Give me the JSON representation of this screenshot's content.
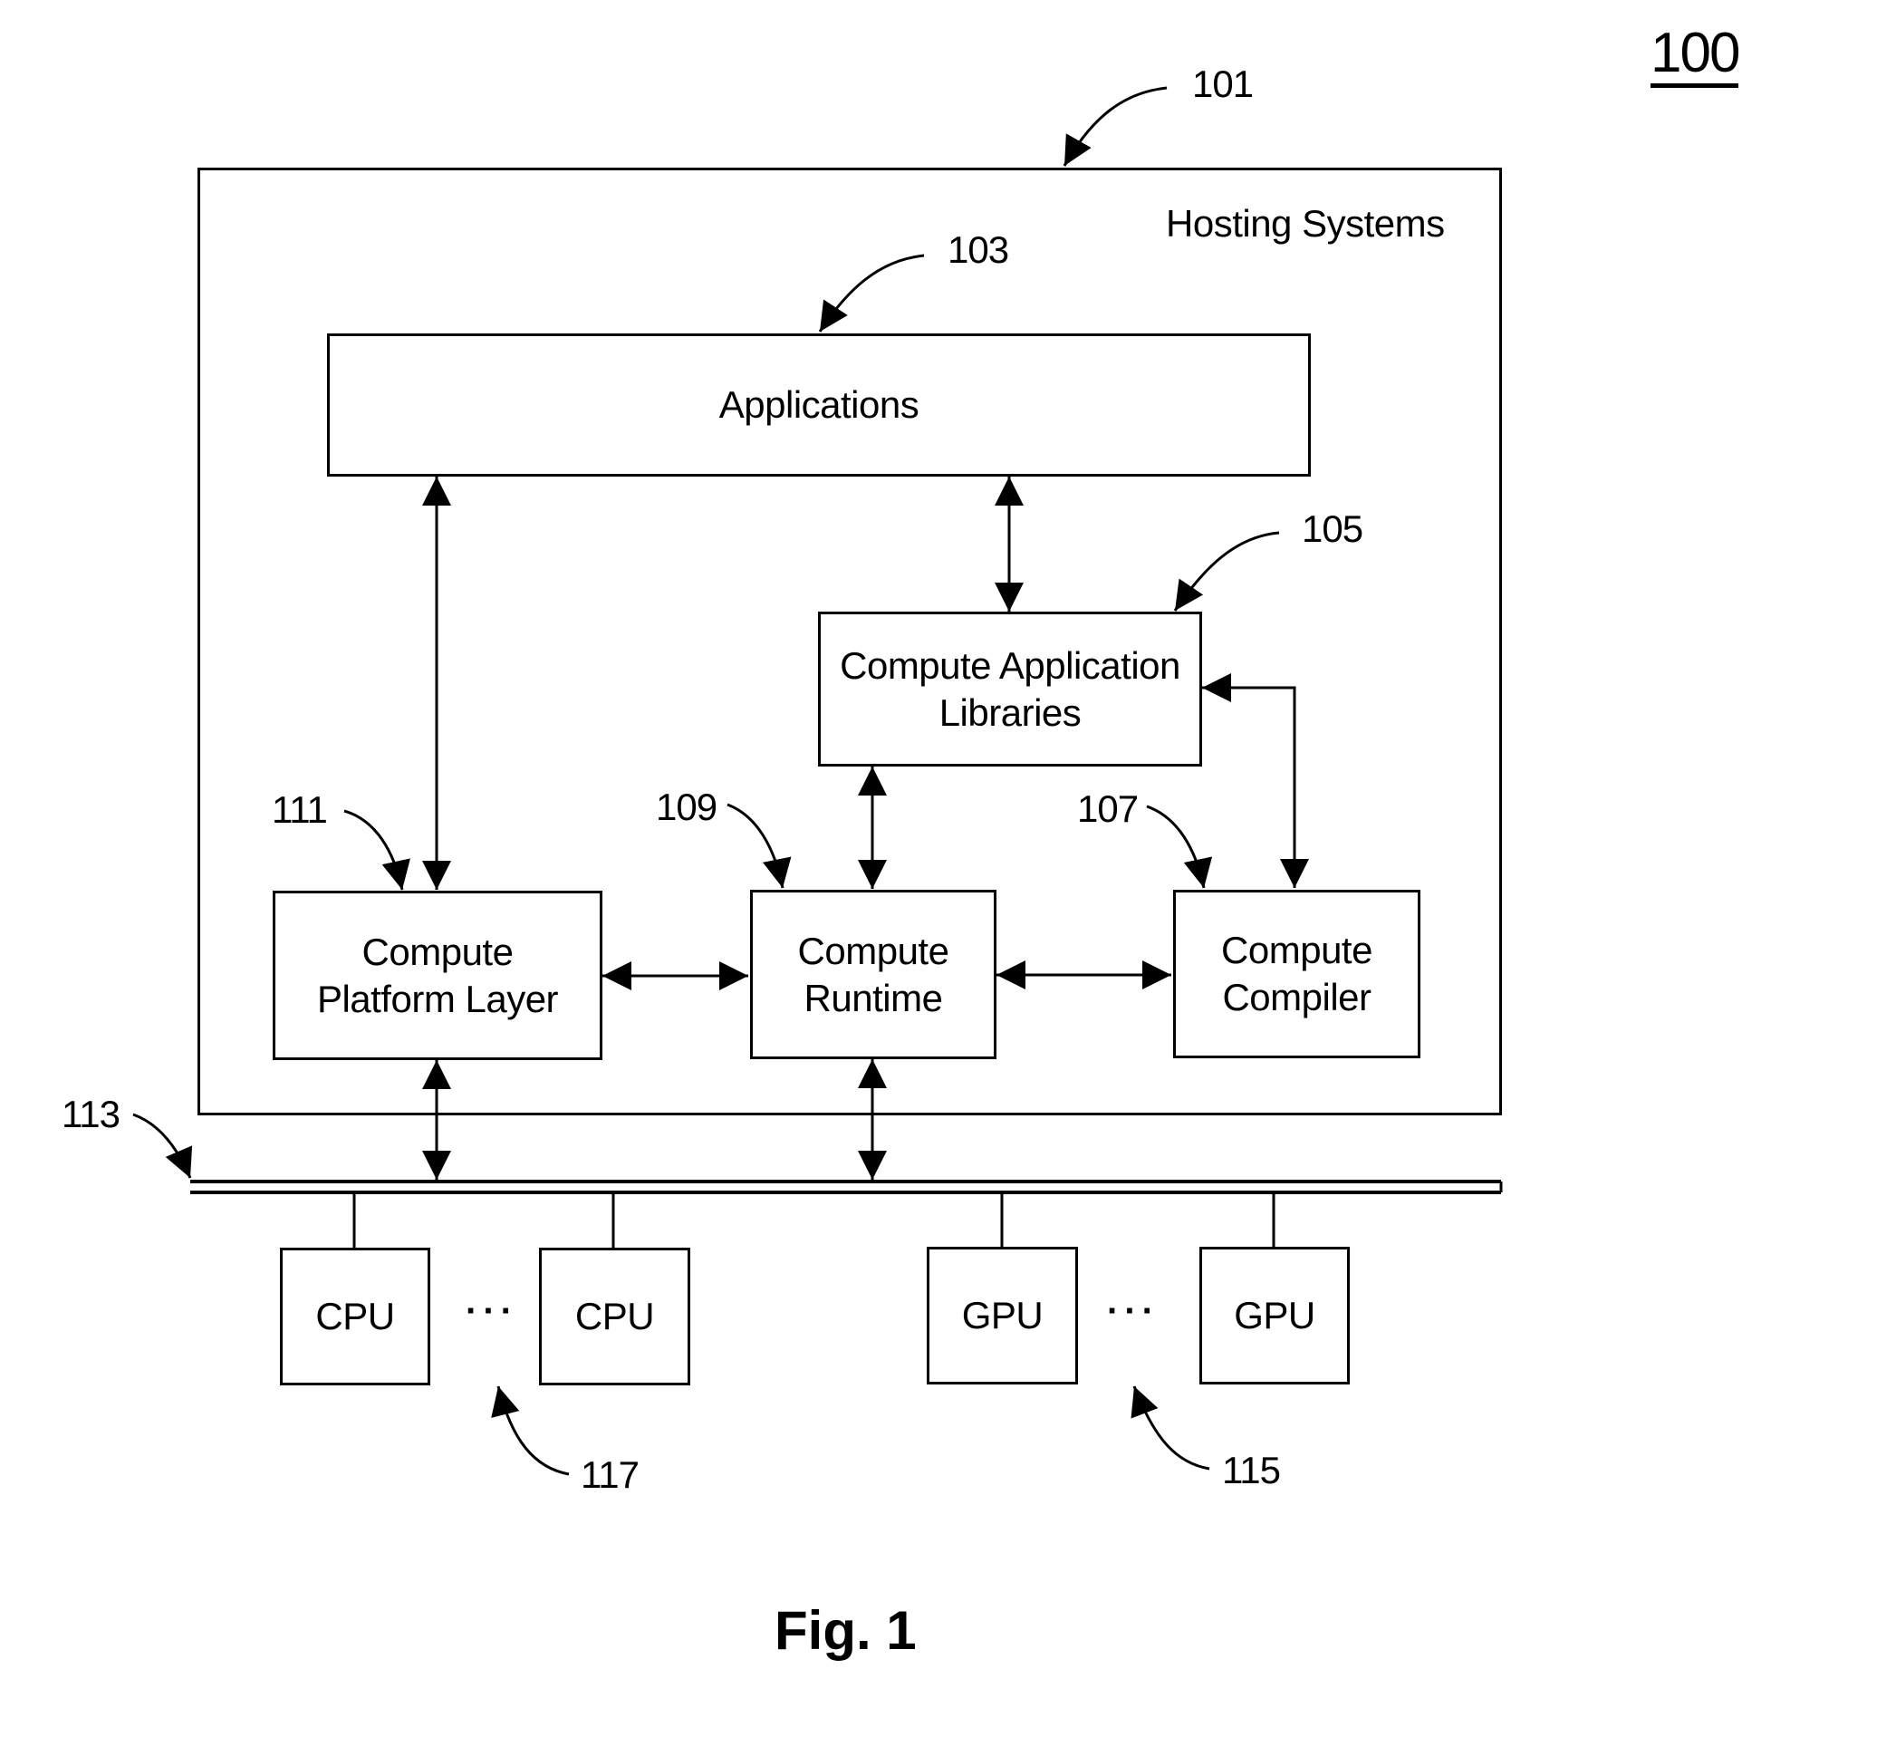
{
  "figure": {
    "number_label": "100",
    "caption": "Fig. 1"
  },
  "hosting_system": {
    "title": "Hosting Systems",
    "ref": "101"
  },
  "blocks": {
    "applications": {
      "label": "Applications",
      "ref": "103"
    },
    "compute_application_libraries": {
      "label": "Compute Application\nLibraries",
      "ref": "105"
    },
    "compute_compiler": {
      "label": "Compute\nCompiler",
      "ref": "107"
    },
    "compute_runtime": {
      "label": "Compute\nRuntime",
      "ref": "109"
    },
    "compute_platform_layer": {
      "label": "Compute\nPlatform Layer",
      "ref": "111"
    }
  },
  "bus": {
    "ref": "113"
  },
  "processors": {
    "gpus": {
      "ref": "115",
      "items": [
        "GPU",
        "GPU"
      ],
      "ellipsis": "···"
    },
    "cpus": {
      "ref": "117",
      "items": [
        "CPU",
        "CPU"
      ],
      "ellipsis": "···"
    }
  },
  "connections": [
    {
      "from": "applications",
      "to": "compute_platform_layer",
      "type": "bidirectional"
    },
    {
      "from": "applications",
      "to": "compute_application_libraries",
      "type": "bidirectional"
    },
    {
      "from": "compute_application_libraries",
      "to": "compute_runtime",
      "type": "bidirectional"
    },
    {
      "from": "compute_application_libraries",
      "to": "compute_compiler",
      "type": "bidirectional"
    },
    {
      "from": "compute_platform_layer",
      "to": "compute_runtime",
      "type": "bidirectional"
    },
    {
      "from": "compute_runtime",
      "to": "compute_compiler",
      "type": "bidirectional"
    },
    {
      "from": "compute_platform_layer",
      "to": "bus",
      "type": "bidirectional"
    },
    {
      "from": "compute_runtime",
      "to": "bus",
      "type": "bidirectional"
    }
  ]
}
